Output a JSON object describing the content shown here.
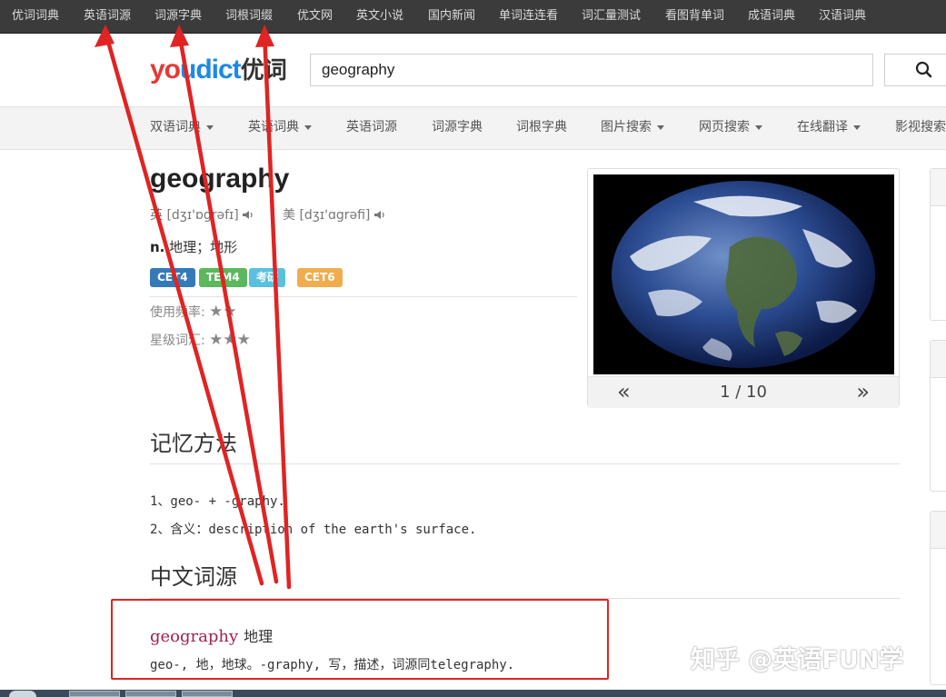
{
  "topbar": {
    "items": [
      "优词词典",
      "英语词源",
      "词源字典",
      "词根词缀",
      "优文网",
      "英文小说",
      "国内新闻",
      "单词连连看",
      "词汇量测试",
      "看图背单词",
      "成语词典",
      "汉语词典"
    ]
  },
  "header": {
    "logo_you": "yo",
    "logo_dict": "udict",
    "logo_cn": "优词",
    "search_value": "geography",
    "search_icon": "search-icon"
  },
  "nav": {
    "items": [
      "双语词典",
      "英语词典",
      "英语词源",
      "词源字典",
      "词根字典",
      "图片搜索",
      "网页搜索",
      "在线翻译",
      "影视搜索"
    ]
  },
  "word": {
    "title": "geography",
    "uk_label": "英",
    "uk_phonetic": "[dʒɪ'ɒgrəfɪ]",
    "us_label": "美",
    "us_phonetic": "[dʒɪ'ɑgrəfi]",
    "pos": "n.",
    "definition": "地理；地形",
    "tags": [
      {
        "label": "CET4",
        "color": "#337ab7"
      },
      {
        "label": "TEM4",
        "color": "#5cb85c"
      },
      {
        "label": "考研",
        "color": "#5bc0de"
      },
      {
        "label": "CET6",
        "color": "#f0ad4e"
      }
    ],
    "frequency_label": "使用频率:",
    "frequency_stars": "★★",
    "level_label": "星级词汇:",
    "level_stars": "★★★"
  },
  "carousel": {
    "prev": "«",
    "next": "»",
    "counter": "1 / 10"
  },
  "memory": {
    "title": "记忆方法",
    "lines": [
      "1、geo- + -graphy.",
      "2、含义：description of the earth's surface."
    ]
  },
  "etymology": {
    "title": "中文词源",
    "word": "geography",
    "meaning": "地理",
    "explanation": "geo-, 地，地球。-graphy, 写，描述，词源同telegraphy."
  },
  "watermark": "知乎 @英语FUN学",
  "colors": {
    "annotation_red": "#e02323",
    "etym_word": "#a0224a",
    "logo_red": "#e53935",
    "logo_blue": "#1e88e5"
  }
}
